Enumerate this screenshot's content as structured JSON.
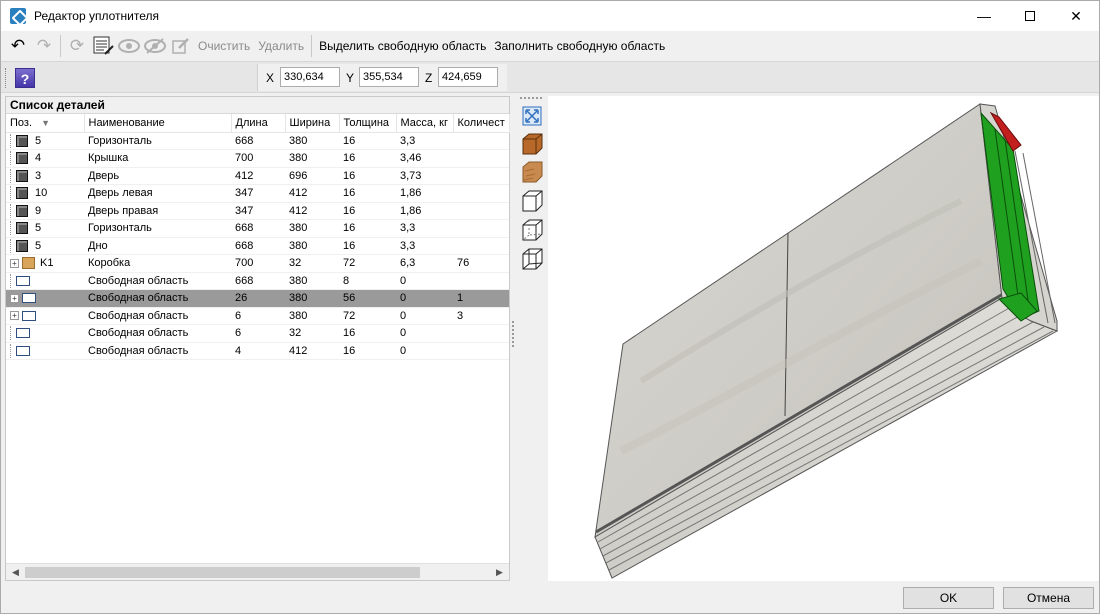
{
  "window": {
    "title": "Редактор уплотнителя"
  },
  "toolbar": {
    "clear_label": "Очистить",
    "delete_label": "Удалить",
    "select_free_label": "Выделить свободную область",
    "fill_free_label": "Заполнить свободную область"
  },
  "coords": {
    "x_label": "X",
    "x_value": "330,634",
    "y_label": "Y",
    "y_value": "355,534",
    "z_label": "Z",
    "z_value": "424,659"
  },
  "help": {
    "label": "?"
  },
  "list": {
    "title": "Список деталей",
    "columns": [
      "Поз.",
      "Наименование",
      "Длина",
      "Ширина",
      "Толщина",
      "Масса, кг",
      "Количест"
    ],
    "rows": [
      {
        "type": "part",
        "pos": "5",
        "name": "Горизонталь",
        "length": "668",
        "width": "380",
        "thickness": "16",
        "mass": "3,3",
        "qty": ""
      },
      {
        "type": "part",
        "pos": "4",
        "name": "Крышка",
        "length": "700",
        "width": "380",
        "thickness": "16",
        "mass": "3,46",
        "qty": ""
      },
      {
        "type": "part",
        "pos": "3",
        "name": "Дверь",
        "length": "412",
        "width": "696",
        "thickness": "16",
        "mass": "3,73",
        "qty": ""
      },
      {
        "type": "part",
        "pos": "10",
        "name": "Дверь левая",
        "length": "347",
        "width": "412",
        "thickness": "16",
        "mass": "1,86",
        "qty": ""
      },
      {
        "type": "part",
        "pos": "9",
        "name": "Дверь правая",
        "length": "347",
        "width": "412",
        "thickness": "16",
        "mass": "1,86",
        "qty": ""
      },
      {
        "type": "part",
        "pos": "5",
        "name": "Горизонталь",
        "length": "668",
        "width": "380",
        "thickness": "16",
        "mass": "3,3",
        "qty": ""
      },
      {
        "type": "part",
        "pos": "5",
        "name": "Дно",
        "length": "668",
        "width": "380",
        "thickness": "16",
        "mass": "3,3",
        "qty": ""
      },
      {
        "type": "box",
        "pos": "K1",
        "name": "Коробка",
        "length": "700",
        "width": "32",
        "thickness": "72",
        "mass": "6,3",
        "qty": "76"
      },
      {
        "type": "free",
        "pos": "",
        "name": "Свободная область",
        "length": "668",
        "width": "380",
        "thickness": "8",
        "mass": "0",
        "qty": ""
      },
      {
        "type": "free-exp",
        "pos": "",
        "name": "Свободная область",
        "length": "26",
        "width": "380",
        "thickness": "56",
        "mass": "0",
        "qty": "1"
      },
      {
        "type": "free-exp",
        "pos": "",
        "name": "Свободная область",
        "length": "6",
        "width": "380",
        "thickness": "72",
        "mass": "0",
        "qty": "3"
      },
      {
        "type": "free",
        "pos": "",
        "name": "Свободная область",
        "length": "6",
        "width": "32",
        "thickness": "16",
        "mass": "0",
        "qty": ""
      },
      {
        "type": "free",
        "pos": "",
        "name": "Свободная область",
        "length": "4",
        "width": "412",
        "thickness": "16",
        "mass": "0",
        "qty": ""
      }
    ],
    "selected_index": 9
  },
  "buttons": {
    "ok": "OK",
    "cancel": "Отмена"
  }
}
